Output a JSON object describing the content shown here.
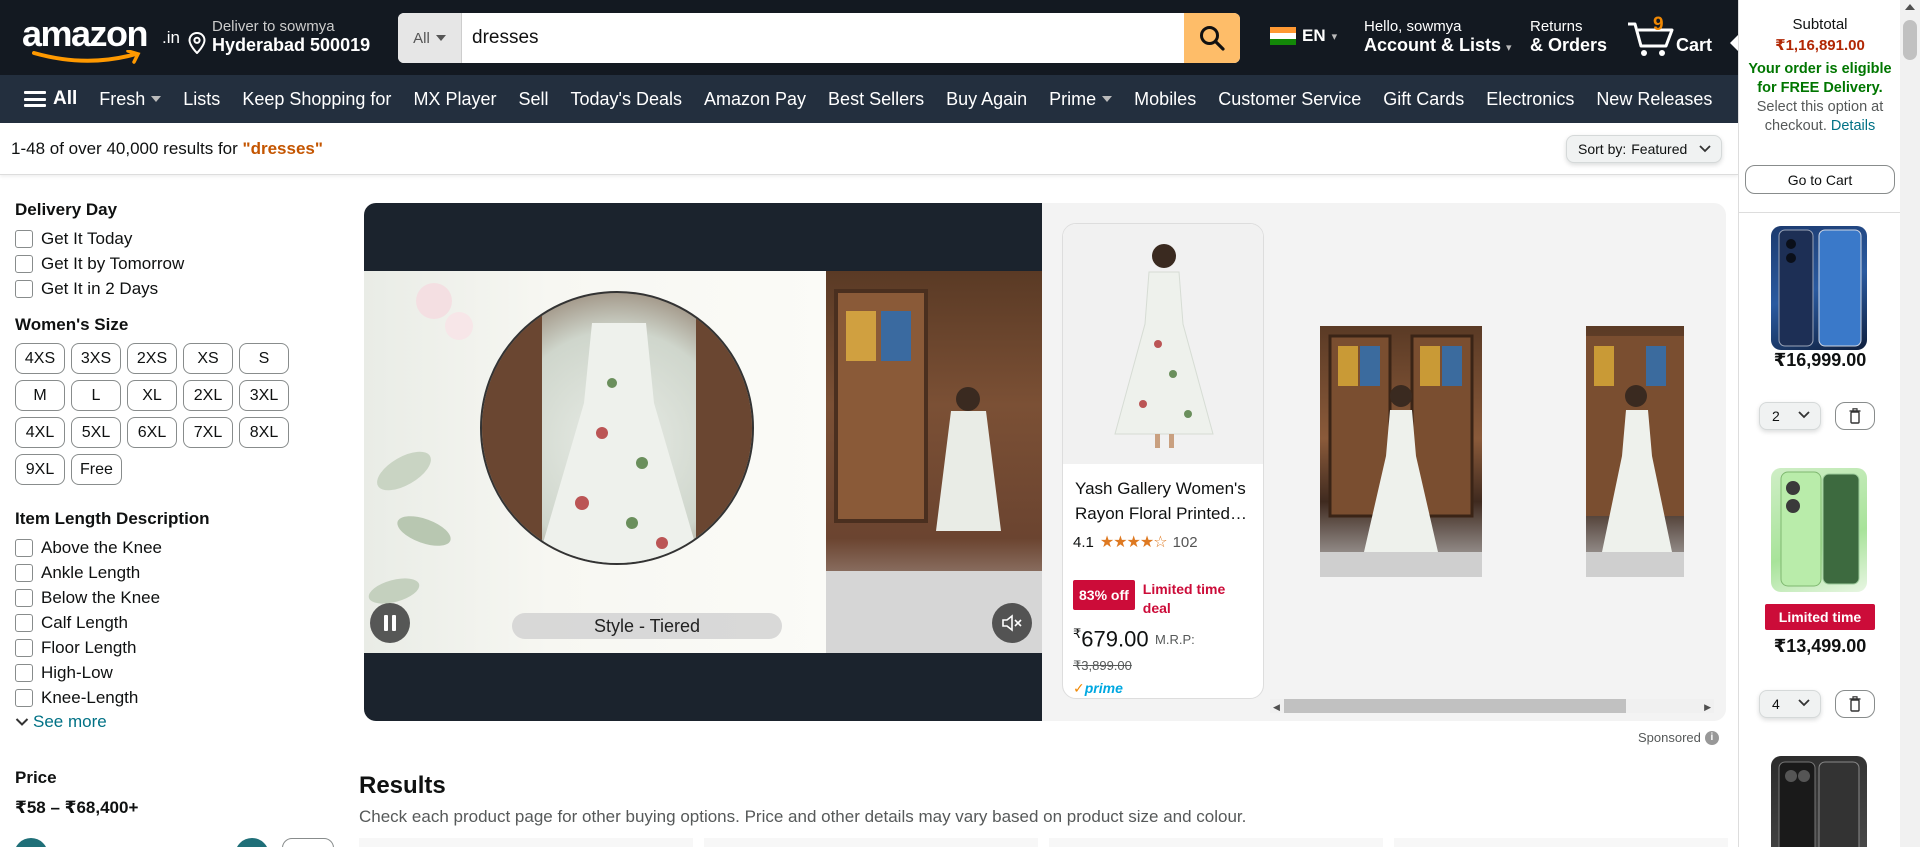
{
  "header": {
    "logo_text": "amazon",
    "logo_tld": ".in",
    "deliver_line1": "Deliver to sowmya",
    "deliver_line2": "Hyderabad 500019",
    "search_category": "All",
    "search_value": "dresses",
    "language": "EN",
    "account_line1": "Hello, sowmya",
    "account_line2": "Account & Lists",
    "orders_line1": "Returns",
    "orders_line2": "& Orders",
    "cart_count": "9",
    "cart_label": "Cart"
  },
  "nav": {
    "all_label": "All",
    "items": [
      "Fresh",
      "Lists",
      "Keep Shopping for",
      "MX Player",
      "Sell",
      "Today's Deals",
      "Amazon Pay",
      "Best Sellers",
      "Buy Again",
      "Prime",
      "Mobiles",
      "Customer Service",
      "Gift Cards",
      "Electronics",
      "New Releases"
    ]
  },
  "results_bar": {
    "count_text": "1-48 of over 40,000 results for",
    "query_text": "\"dresses\"",
    "sort_label": "Sort by:",
    "sort_value": "Featured"
  },
  "filters": {
    "delivery_heading": "Delivery Day",
    "delivery_options": [
      "Get It Today",
      "Get It by Tomorrow",
      "Get It in 2 Days"
    ],
    "size_heading": "Women's Size",
    "sizes": [
      "4XS",
      "3XS",
      "2XS",
      "XS",
      "S",
      "M",
      "L",
      "XL",
      "2XL",
      "3XL",
      "4XL",
      "5XL",
      "6XL",
      "7XL",
      "8XL",
      "9XL",
      "Free"
    ],
    "length_heading": "Item Length Description",
    "length_options": [
      "Above the Knee",
      "Ankle Length",
      "Below the Knee",
      "Calf Length",
      "Floor Length",
      "High-Low",
      "Knee-Length"
    ],
    "see_more": "See more",
    "price_heading": "Price",
    "price_range": "₹58 – ₹68,400+"
  },
  "sponsored": {
    "video_caption": "Style - Tiered",
    "product_title": "Yash Gallery Women's Rayon Floral Printed…",
    "rating": "4.1",
    "stars": "★★★★☆",
    "review_count": "102",
    "discount_badge": "83% off",
    "deal_text": "Limited time deal",
    "price_symbol": "₹",
    "price": "679.00",
    "mrp_label": "M.R.P:",
    "mrp_value": "₹3,899.00",
    "prime_label": "prime",
    "sponsored_label": "Sponsored"
  },
  "results": {
    "heading": "Results",
    "subtext": "Check each product page for other buying options. Price and other details may vary based on product size and colour."
  },
  "cart_panel": {
    "subtotal_label": "Subtotal",
    "subtotal_value": "₹1,16,891.00",
    "eligible_text": "Your order is eligible for FREE Delivery.",
    "select_text": "Select this option at checkout.",
    "details_link": "Details",
    "go_to_cart": "Go to Cart",
    "items": [
      {
        "price": "₹16,999.00",
        "qty": "2",
        "badge": ""
      },
      {
        "price": "₹13,499.00",
        "qty": "4",
        "badge": "Limited time"
      }
    ]
  },
  "colors": {
    "header_bg": "#131921",
    "nav_bg": "#232F3E",
    "search_button": "#FEBD69",
    "deal_red": "#CC0C39",
    "link_teal": "#007185",
    "price_red": "#B12704"
  }
}
